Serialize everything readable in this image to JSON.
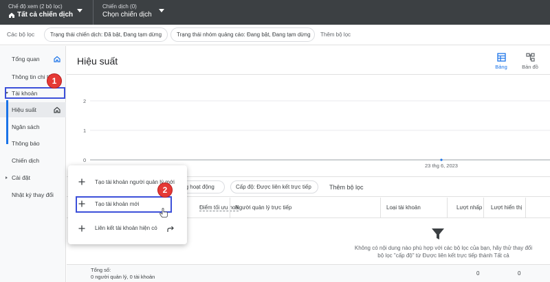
{
  "topbar": {
    "view_mode_small": "Chế độ xem (2 bộ lọc)",
    "view_mode_value": "Tất cả chiến dịch",
    "campaign_small": "Chiến dịch (0)",
    "campaign_value": "Chọn chiến dịch"
  },
  "filterbar": {
    "label": "Các bộ lọc",
    "chips": [
      "Trạng thái chiến dịch: Đã bật, Đang tạm dừng",
      "Trạng thái nhóm quảng cáo: Đang bật, Đang tạm dừng"
    ],
    "add_filter": "Thêm bộ lọc"
  },
  "leftnav": {
    "items": [
      {
        "label": "Tổng quan",
        "icon": "home-icon"
      },
      {
        "label": "Thông tin chi tiết"
      },
      {
        "label": "Tài khoản",
        "expanded": true
      },
      {
        "label": "Hiệu suất",
        "icon": "home-icon",
        "active": true
      },
      {
        "label": "Ngân sách"
      },
      {
        "label": "Thông báo"
      },
      {
        "label": "Chiến dịch"
      },
      {
        "label": "Cài đặt",
        "expanded": false
      },
      {
        "label": "Nhật ký thay đổi"
      }
    ]
  },
  "main": {
    "title": "Hiệu suất",
    "view_buttons": [
      {
        "label": "Bảng",
        "icon": "table-icon",
        "active": true
      },
      {
        "label": "Bản đồ",
        "icon": "hierarchy-icon",
        "active": false
      }
    ]
  },
  "chart_data": {
    "type": "line",
    "x": [
      "23 thg 6, 2023"
    ],
    "series": [
      {
        "values": [
          0
        ]
      }
    ],
    "yticks": [
      0,
      1,
      2
    ],
    "ylim": [
      0,
      2
    ],
    "xlabel": "",
    "ylabel": "",
    "title": "",
    "grid": true
  },
  "row2": {
    "chips": [
      "...ang hoạt động",
      "Cấp độ: Được liên kết trực tiếp"
    ],
    "add_filter": "Thêm bộ lọc"
  },
  "table": {
    "headers": [
      "Điểm tối ưu hoá",
      "Người quản lý trực tiếp",
      "Loại tài khoản",
      "Lượt nhấp",
      "Lượt hiển thị"
    ],
    "empty_message": "Không có nội dung nào phù hợp với các bộ lọc của bạn, hãy thử thay đổi bộ lọc \"cấp độ\" từ Được liên kết trực tiếp thành Tất cả",
    "total_label": "Tổng số:",
    "total_sub": "0 người quản lý, 0 tài khoản",
    "total_clicks": "0",
    "total_impressions": "0"
  },
  "popup": {
    "items": [
      "Tạo tài khoản người quản lý mới",
      "Tạo tài khoản mới",
      "Liên kết tài khoản hiện có"
    ]
  },
  "annotations": {
    "badge1": "1",
    "badge2": "2",
    "highlight_color": "#3b4fd9",
    "badge_color": "#e53935"
  },
  "colors": {
    "topbar_bg": "#3c4043",
    "accent": "#1a73e8",
    "nav_bg": "#f8f9fa"
  }
}
